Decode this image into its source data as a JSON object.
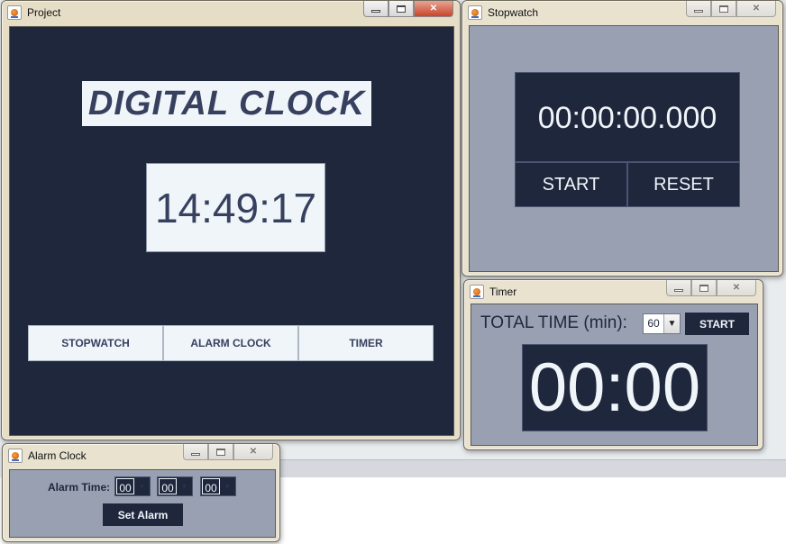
{
  "project": {
    "window_title": "Project",
    "heading": "DIGITAL CLOCK",
    "time": "14:49:17",
    "nav": [
      "STOPWATCH",
      "ALARM CLOCK",
      "TIMER"
    ]
  },
  "stopwatch": {
    "window_title": "Stopwatch",
    "display": "00:00:00.000",
    "start_label": "START",
    "reset_label": "RESET"
  },
  "timer": {
    "window_title": "Timer",
    "total_label": "TOTAL TIME (min):",
    "minutes_value": "60",
    "start_label": "START",
    "display": "00:00"
  },
  "alarm": {
    "window_title": "Alarm Clock",
    "label": "Alarm Time:",
    "hour": "00",
    "minute": "00",
    "second": "00",
    "set_label": "Set Alarm"
  },
  "theme": {
    "dark_navy": "#1f273d",
    "panel_gray": "#98a0b1",
    "light": "#f0f5f9",
    "text_navy": "#37415f"
  }
}
